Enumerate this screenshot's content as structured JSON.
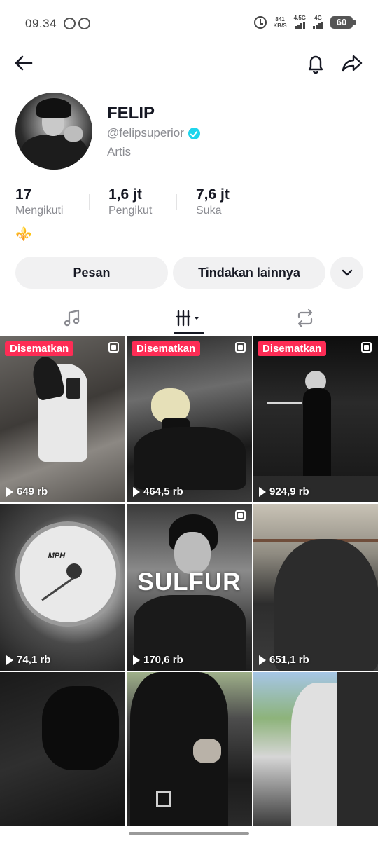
{
  "status_bar": {
    "time": "09.34",
    "net_speed_value": "841",
    "net_speed_unit": "KB/S",
    "signal_1_label": "4.5G",
    "signal_2_label": "4G",
    "battery": "60"
  },
  "nav": {
    "back_icon": "arrow-left-icon",
    "bell_icon": "bell-icon",
    "share_icon": "share-arrow-icon"
  },
  "profile": {
    "name": "FELIP",
    "handle": "@felipsuperior",
    "category": "Artis",
    "bio_emoji": "⚜️"
  },
  "stats": [
    {
      "value": "17",
      "label": "Mengikuti"
    },
    {
      "value": "1,6 jt",
      "label": "Pengikut"
    },
    {
      "value": "7,6 jt",
      "label": "Suka"
    }
  ],
  "actions": {
    "message": "Pesan",
    "more": "Tindakan lainnya"
  },
  "tabs": [
    {
      "icon": "music-note-icon",
      "active": false
    },
    {
      "icon": "grid-icon",
      "active": true
    },
    {
      "icon": "repost-icon",
      "active": false
    }
  ],
  "grid": [
    {
      "pinned": "Disematkan",
      "views": "649 rb",
      "multi": true
    },
    {
      "pinned": "Disematkan",
      "views": "464,5 rb",
      "multi": true
    },
    {
      "pinned": "Disematkan",
      "views": "924,9 rb",
      "multi": true
    },
    {
      "views": "74,1 rb",
      "gauge_label": "MPH"
    },
    {
      "views": "170,6 rb",
      "overlay_text": "SULFUR",
      "multi": true
    },
    {
      "views": "651,1 rb"
    },
    {
      "views": "",
      "partial": true
    },
    {
      "views": "",
      "partial": true
    },
    {
      "views": "",
      "partial": true
    }
  ],
  "colors": {
    "accent": "#fe2c55",
    "verified": "#20d5ec",
    "secondary_text": "#8a8b91",
    "button_bg": "#f1f1f2"
  }
}
